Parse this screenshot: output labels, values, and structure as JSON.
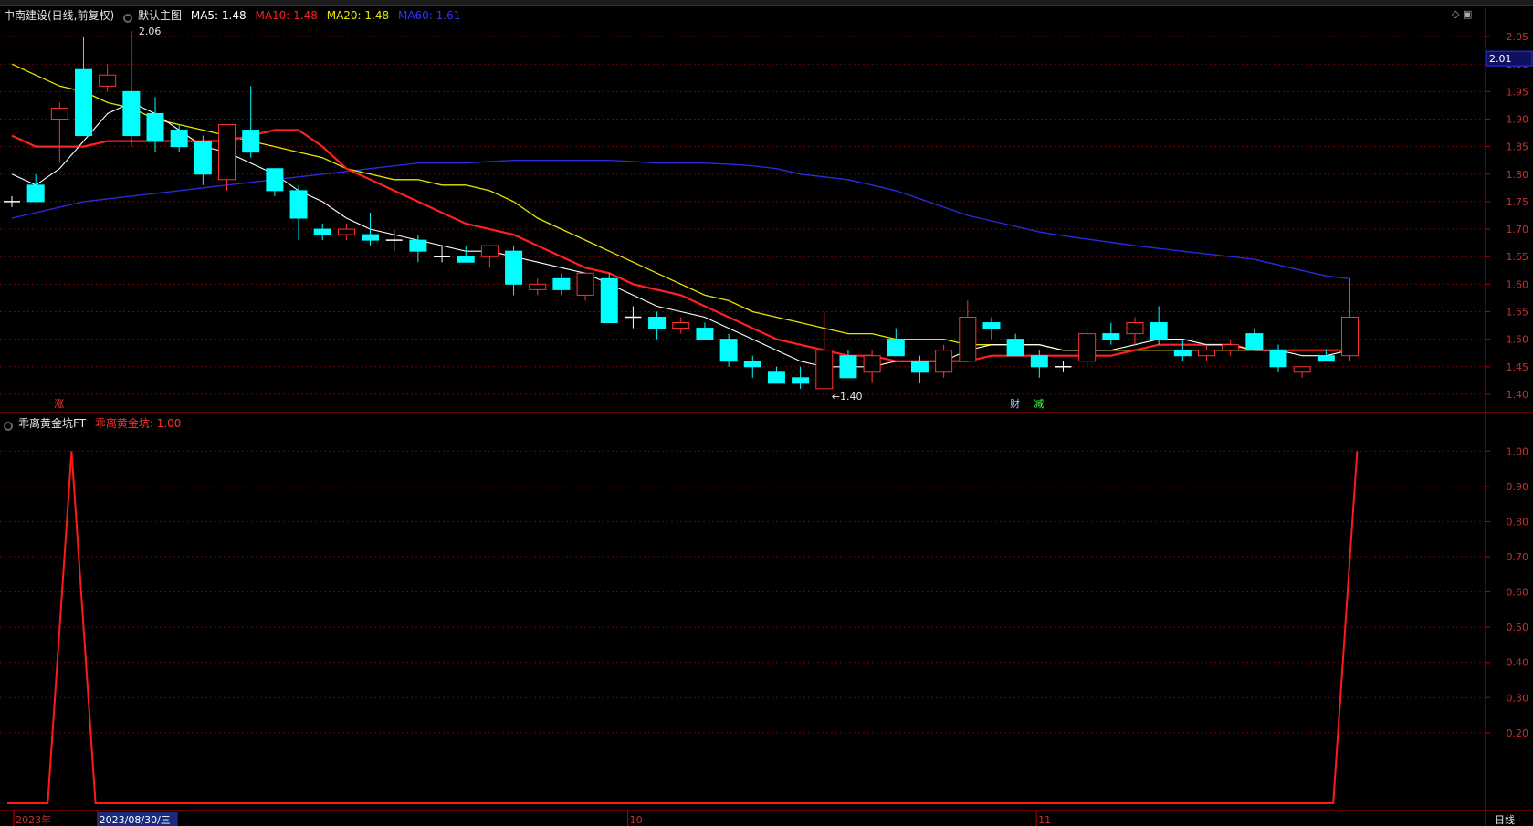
{
  "title_bar": {
    "stock": "中南建设(日线,前复权)",
    "main_chart": "默认主图",
    "ma5": "MA5: 1.48",
    "ma10": "MA10: 1.48",
    "ma20": "MA20: 1.48",
    "ma60": "MA60: 1.61"
  },
  "indicator_title": {
    "name": "乖离黄金坑FT",
    "value": "乖离黄金坑: 1.00"
  },
  "colors": {
    "up": "#ff3333",
    "down": "#00ffff",
    "ma5": "#ffffff",
    "ma10": "#ff2020",
    "ma20": "#e6e600",
    "ma60": "#2b2bdd",
    "grid": "#7a0000",
    "axis": "#c00000"
  },
  "chart_data": {
    "type": "candlestick",
    "price_axis": {
      "ylim": [
        1.37,
        2.07
      ],
      "ticks": [
        "2.05",
        "2.00",
        "1.95",
        "1.90",
        "1.85",
        "1.80",
        "1.75",
        "1.70",
        "1.65",
        "1.60",
        "1.55",
        "1.50",
        "1.45",
        "1.40"
      ],
      "current": "2.01"
    },
    "candles": [
      [
        1.75,
        1.76,
        1.74,
        1.75
      ],
      [
        1.78,
        1.8,
        1.75,
        1.75
      ],
      [
        1.9,
        1.93,
        1.82,
        1.92
      ],
      [
        1.99,
        2.05,
        1.88,
        1.87
      ],
      [
        1.96,
        2.0,
        1.95,
        1.98
      ],
      [
        1.95,
        2.06,
        1.85,
        1.87
      ],
      [
        1.91,
        1.94,
        1.84,
        1.86
      ],
      [
        1.88,
        1.89,
        1.84,
        1.85
      ],
      [
        1.86,
        1.87,
        1.78,
        1.8
      ],
      [
        1.79,
        1.89,
        1.77,
        1.89
      ],
      [
        1.88,
        1.96,
        1.83,
        1.84
      ],
      [
        1.81,
        1.81,
        1.76,
        1.77
      ],
      [
        1.77,
        1.78,
        1.68,
        1.72
      ],
      [
        1.7,
        1.71,
        1.68,
        1.69
      ],
      [
        1.69,
        1.71,
        1.68,
        1.7
      ],
      [
        1.69,
        1.73,
        1.67,
        1.68
      ],
      [
        1.68,
        1.7,
        1.66,
        1.68
      ],
      [
        1.68,
        1.69,
        1.64,
        1.66
      ],
      [
        1.65,
        1.67,
        1.64,
        1.65
      ],
      [
        1.65,
        1.67,
        1.64,
        1.64
      ],
      [
        1.65,
        1.67,
        1.63,
        1.67
      ],
      [
        1.66,
        1.67,
        1.58,
        1.6
      ],
      [
        1.59,
        1.61,
        1.58,
        1.6
      ],
      [
        1.61,
        1.62,
        1.58,
        1.59
      ],
      [
        1.58,
        1.62,
        1.57,
        1.62
      ],
      [
        1.61,
        1.62,
        1.53,
        1.53
      ],
      [
        1.54,
        1.56,
        1.52,
        1.54
      ],
      [
        1.54,
        1.55,
        1.5,
        1.52
      ],
      [
        1.52,
        1.54,
        1.51,
        1.53
      ],
      [
        1.52,
        1.53,
        1.5,
        1.5
      ],
      [
        1.5,
        1.51,
        1.45,
        1.46
      ],
      [
        1.46,
        1.47,
        1.43,
        1.45
      ],
      [
        1.44,
        1.45,
        1.42,
        1.42
      ],
      [
        1.43,
        1.45,
        1.41,
        1.42
      ],
      [
        1.41,
        1.55,
        1.41,
        1.48
      ],
      [
        1.47,
        1.48,
        1.43,
        1.43
      ],
      [
        1.44,
        1.48,
        1.42,
        1.47
      ],
      [
        1.5,
        1.52,
        1.47,
        1.47
      ],
      [
        1.46,
        1.47,
        1.42,
        1.44
      ],
      [
        1.44,
        1.49,
        1.43,
        1.48
      ],
      [
        1.46,
        1.57,
        1.46,
        1.54
      ],
      [
        1.53,
        1.54,
        1.5,
        1.52
      ],
      [
        1.5,
        1.51,
        1.47,
        1.47
      ],
      [
        1.47,
        1.48,
        1.43,
        1.45
      ],
      [
        1.45,
        1.46,
        1.44,
        1.45
      ],
      [
        1.46,
        1.52,
        1.45,
        1.51
      ],
      [
        1.51,
        1.53,
        1.49,
        1.5
      ],
      [
        1.51,
        1.54,
        1.49,
        1.53
      ],
      [
        1.53,
        1.56,
        1.49,
        1.5
      ],
      [
        1.48,
        1.5,
        1.46,
        1.47
      ],
      [
        1.47,
        1.49,
        1.46,
        1.48
      ],
      [
        1.48,
        1.5,
        1.47,
        1.49
      ],
      [
        1.51,
        1.52,
        1.48,
        1.48
      ],
      [
        1.48,
        1.49,
        1.44,
        1.45
      ],
      [
        1.44,
        1.45,
        1.43,
        1.45
      ],
      [
        1.47,
        1.48,
        1.46,
        1.46
      ],
      [
        1.47,
        1.61,
        1.46,
        1.54
      ]
    ],
    "ma5": [
      1.8,
      1.78,
      1.81,
      1.86,
      1.91,
      1.93,
      1.91,
      1.88,
      1.85,
      1.84,
      1.82,
      1.8,
      1.77,
      1.75,
      1.72,
      1.7,
      1.69,
      1.68,
      1.67,
      1.66,
      1.66,
      1.65,
      1.64,
      1.63,
      1.62,
      1.6,
      1.58,
      1.56,
      1.55,
      1.54,
      1.52,
      1.5,
      1.48,
      1.46,
      1.45,
      1.45,
      1.45,
      1.46,
      1.46,
      1.46,
      1.48,
      1.49,
      1.49,
      1.49,
      1.48,
      1.48,
      1.48,
      1.49,
      1.5,
      1.5,
      1.49,
      1.49,
      1.48,
      1.48,
      1.47,
      1.47,
      1.48
    ],
    "ma10": [
      1.87,
      1.85,
      1.85,
      1.85,
      1.86,
      1.86,
      1.86,
      1.86,
      1.86,
      1.86,
      1.87,
      1.88,
      1.88,
      1.85,
      1.81,
      1.79,
      1.77,
      1.75,
      1.73,
      1.71,
      1.7,
      1.69,
      1.67,
      1.65,
      1.63,
      1.62,
      1.6,
      1.59,
      1.58,
      1.56,
      1.54,
      1.52,
      1.5,
      1.49,
      1.48,
      1.47,
      1.47,
      1.46,
      1.46,
      1.46,
      1.46,
      1.47,
      1.47,
      1.47,
      1.47,
      1.47,
      1.47,
      1.48,
      1.49,
      1.49,
      1.49,
      1.49,
      1.48,
      1.48,
      1.48,
      1.48,
      1.48
    ],
    "ma20": [
      2.0,
      1.98,
      1.96,
      1.95,
      1.93,
      1.92,
      1.9,
      1.89,
      1.88,
      1.87,
      1.86,
      1.85,
      1.84,
      1.83,
      1.81,
      1.8,
      1.79,
      1.79,
      1.78,
      1.78,
      1.77,
      1.75,
      1.72,
      1.7,
      1.68,
      1.66,
      1.64,
      1.62,
      1.6,
      1.58,
      1.57,
      1.55,
      1.54,
      1.53,
      1.52,
      1.51,
      1.51,
      1.5,
      1.5,
      1.5,
      1.49,
      1.49,
      1.49,
      1.49,
      1.48,
      1.48,
      1.48,
      1.48,
      1.48,
      1.48,
      1.48,
      1.48,
      1.48,
      1.48,
      1.48,
      1.48,
      1.48
    ],
    "ma60": [
      1.72,
      1.73,
      1.74,
      1.75,
      1.755,
      1.76,
      1.765,
      1.77,
      1.775,
      1.78,
      1.785,
      1.79,
      1.795,
      1.8,
      1.805,
      1.81,
      1.815,
      1.82,
      1.82,
      1.82,
      1.823,
      1.825,
      1.825,
      1.825,
      1.825,
      1.825,
      1.823,
      1.82,
      1.82,
      1.82,
      1.818,
      1.815,
      1.81,
      1.8,
      1.795,
      1.79,
      1.78,
      1.77,
      1.755,
      1.74,
      1.725,
      1.715,
      1.705,
      1.695,
      1.688,
      1.682,
      1.676,
      1.67,
      1.665,
      1.66,
      1.655,
      1.65,
      1.645,
      1.635,
      1.625,
      1.615,
      1.61
    ],
    "price_annotations": [
      {
        "text": "2.06",
        "index": 5,
        "value": 2.06
      },
      {
        "text": "←1.40",
        "index": 34,
        "value": 1.41
      }
    ],
    "markers": [
      {
        "text": "涨",
        "index": 2,
        "color": "#ff4040"
      },
      {
        "text": "财",
        "index": 42,
        "color": "#9fd0ff"
      },
      {
        "text": "减",
        "index": 43,
        "color": "#40ff40"
      }
    ],
    "indicator": {
      "name": "乖离黄金坑",
      "ylim": [
        0,
        1.05
      ],
      "ticks": [
        "1.00",
        "0.90",
        "0.80",
        "0.70",
        "0.60",
        "0.50",
        "0.40",
        "0.30",
        "0.20"
      ],
      "x": [
        0,
        1.5,
        2.5,
        3.5,
        55.3,
        56.3
      ],
      "values": [
        0,
        0,
        1,
        0,
        0,
        1
      ]
    },
    "date_axis": {
      "labels": [
        {
          "text": "2023年",
          "index": 0.5
        },
        {
          "text": "2023/08/30/三",
          "index": 4,
          "highlight": true
        },
        {
          "text": "10",
          "index": 26.2
        },
        {
          "text": "11",
          "index": 43.3
        }
      ],
      "period": "日线"
    }
  }
}
